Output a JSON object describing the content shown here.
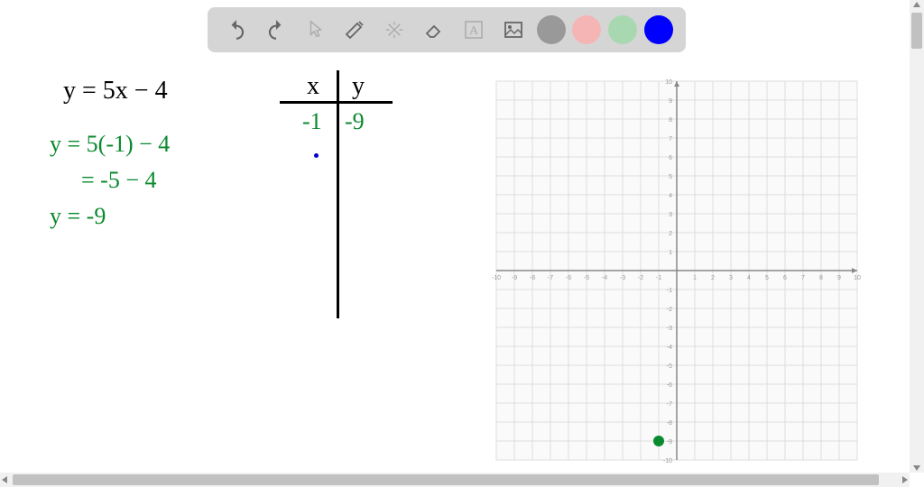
{
  "toolbar": {
    "colors": {
      "gray": "#999999",
      "pink": "#f5b5b5",
      "green": "#a8d8b0",
      "blue": "#0000ff"
    }
  },
  "equations": {
    "main": "y = 5x − 4",
    "sub1": "y = 5(-1) − 4",
    "sub2": "= -5 − 4",
    "sub3": "y = -9"
  },
  "table": {
    "header_x": "x",
    "header_y": "y",
    "rows": [
      {
        "x": "-1",
        "y": "-9"
      }
    ]
  },
  "chart_data": {
    "type": "scatter",
    "title": "",
    "xlabel": "",
    "ylabel": "",
    "xlim": [
      -10,
      10
    ],
    "ylim": [
      -10,
      10
    ],
    "x_ticks": [
      -10,
      -9,
      -8,
      -7,
      -6,
      -5,
      -4,
      -3,
      -2,
      -1,
      1,
      2,
      3,
      4,
      5,
      6,
      7,
      8,
      9,
      10
    ],
    "y_ticks": [
      -10,
      -9,
      -8,
      -7,
      -6,
      -5,
      -4,
      -3,
      -2,
      -1,
      1,
      2,
      3,
      4,
      5,
      6,
      7,
      8,
      9,
      10
    ],
    "grid": true,
    "points": [
      {
        "x": -1,
        "y": -9,
        "color": "#0a8a2e"
      }
    ]
  }
}
